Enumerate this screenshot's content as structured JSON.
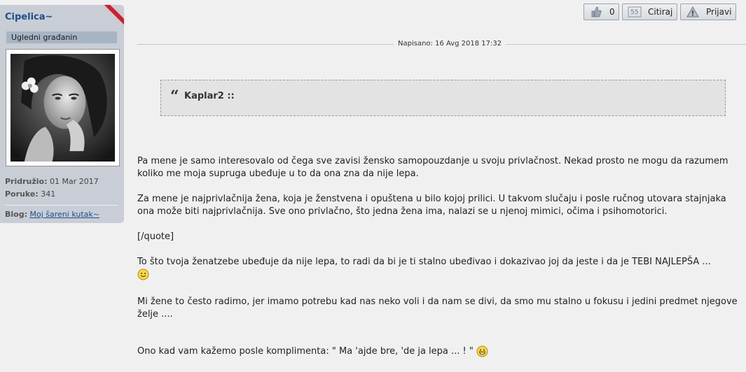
{
  "user": {
    "name": "Cipelica~",
    "rank": "Ugledni građanin",
    "joined_label": "Pridružio:",
    "joined_value": "01 Mar 2017",
    "posts_label": "Poruke:",
    "posts_value": "341",
    "blog_label": "Blog:",
    "blog_link": "Moj šareni kutak~"
  },
  "actions": {
    "like_count": "0",
    "quote_label": "Citiraj",
    "report_label": "Prijavi"
  },
  "post": {
    "date": "Napisano: 16 Avg 2018 17:32",
    "quote_author": "Kaplar2 ::",
    "paragraphs": {
      "p1": "Pa mene je samo interesovalo od čega sve zavisi žensko samopouzdanje u svoju privlačnost. Nekad prosto ne mogu da razumem koliko me moja supruga ubeđuje u to da ona zna da nije lepa.",
      "p2": "Za mene je najprivlačnija žena, koja je ženstvena i opuštena u bilo kojoj prilici. U takvom slučaju i posle ručnog utovara stajnjaka ona može biti najprivlačnija. Sve ono privlačno, što jedna žena ima, nalazi se u njenoj mimici, očima i psihomotorici.",
      "p3": "[/quote]",
      "p4": "To što tvoja ženatzebe ubeđuje da nije lepa, to radi da bi je ti stalno ubeđivao i dokazivao joj da jeste i da je TEBI NAJLEPŠA ...",
      "p5": "Mi žene to često radimo, jer imamo potrebu kad nas neko voli i da nam se divi, da smo mu stalno u fokusu i jedini predmet njegove želje ....",
      "p6": "Ono kad vam kažemo posle komplimenta: \" Ma 'ajde bre, 'de ja lepa ... ! \""
    }
  },
  "colors": {
    "username": "#1c4f87",
    "panel_bg": "#c9ced6",
    "ribbon": "#d0202e",
    "page_bg": "#f0f0f0"
  },
  "icons": {
    "like": "thumbs-up-icon",
    "quote": "quote-icon",
    "report": "warning-icon",
    "smile": "smiley-icon",
    "grin": "grin-icon"
  }
}
